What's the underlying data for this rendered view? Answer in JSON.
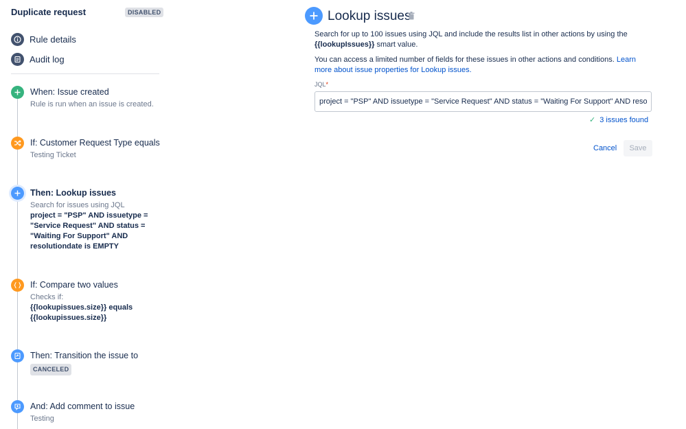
{
  "rule": {
    "title": "Duplicate request",
    "status_badge": "DISABLED"
  },
  "nav": {
    "rule_details": "Rule details",
    "audit_log": "Audit log"
  },
  "steps": [
    {
      "title": "When: Issue created",
      "desc": "Rule is run when an issue is created.",
      "icon": "plus-icon",
      "color": "#36b37e"
    },
    {
      "title": "If: Customer Request Type equals",
      "desc": "Testing Ticket",
      "icon": "shuffle-icon",
      "color": "#ff991f"
    },
    {
      "title": "Then: Lookup issues",
      "desc_prefix": "Search for issues using JQL",
      "desc_bold": "project = \"PSP\" AND issuetype = \"Service Request\" AND status = \"Waiting For Support\" AND resolutiondate is EMPTY",
      "icon": "plus-icon",
      "color": "#4c9aff"
    },
    {
      "title": "If: Compare two values",
      "desc_prefix": "Checks if:",
      "desc_bold": "{{lookupissues.size}} equals {{lookupissues.size}}",
      "icon": "braces-icon",
      "color": "#ff991f"
    },
    {
      "title": "Then: Transition the issue to",
      "lozenge": "CANCELED",
      "icon": "transition-icon",
      "color": "#4c9aff"
    },
    {
      "title": "And: Add comment to issue",
      "desc": "Testing",
      "icon": "comment-icon",
      "color": "#4c9aff"
    }
  ],
  "panel": {
    "title": "Lookup issues",
    "para1_prefix": "Search for up to 100 issues using JQL and include the results list in other actions by using the",
    "para1_bold": "{{lookupIssues}}",
    "para1_suffix": "smart value.",
    "para2_prefix": "You can access a limited number of fields for these issues in other actions and conditions.",
    "para2_link": "Learn more about issue properties for Lookup issues.",
    "jql_label": "JQL",
    "jql_required": "*",
    "jql_value": "project = \"PSP\" AND issuetype = \"Service Request\" AND status = \"Waiting For Support\" AND resolutiondate is EMPTY",
    "issues_found": "3 issues found",
    "cancel_label": "Cancel",
    "save_label": "Save"
  }
}
